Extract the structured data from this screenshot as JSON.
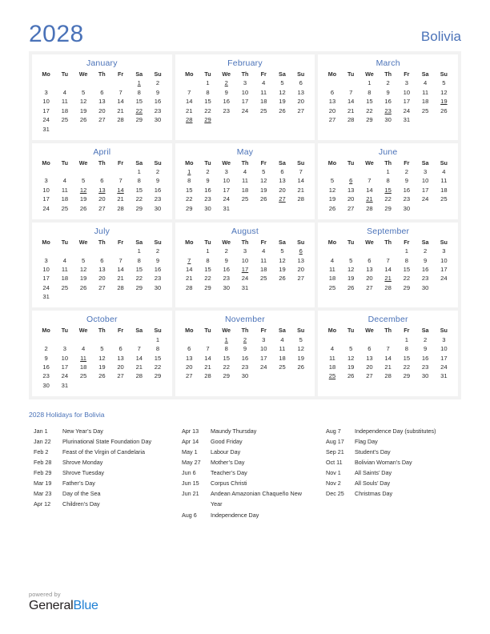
{
  "header": {
    "year": "2028",
    "country": "Bolivia"
  },
  "colors": {
    "accent_blue": "#4a72b8",
    "holiday_red": "#e8000d",
    "panel_gray": "#f2f2f2",
    "brand_blue": "#1d7fd4"
  },
  "weekday_headers": [
    "Mo",
    "Tu",
    "We",
    "Th",
    "Fr",
    "Sa",
    "Su"
  ],
  "months": [
    {
      "name": "January",
      "lead_blanks": 5,
      "days": 31,
      "holidays": [
        1,
        22
      ]
    },
    {
      "name": "February",
      "lead_blanks": 1,
      "days": 29,
      "holidays": [
        2,
        28,
        29
      ]
    },
    {
      "name": "March",
      "lead_blanks": 2,
      "days": 31,
      "holidays": [
        19,
        23
      ]
    },
    {
      "name": "April",
      "lead_blanks": 5,
      "days": 30,
      "holidays": [
        12,
        13,
        14
      ]
    },
    {
      "name": "May",
      "lead_blanks": 0,
      "days": 31,
      "holidays": [
        1,
        27
      ]
    },
    {
      "name": "June",
      "lead_blanks": 3,
      "days": 30,
      "holidays": [
        6,
        15,
        21
      ]
    },
    {
      "name": "July",
      "lead_blanks": 5,
      "days": 31,
      "holidays": []
    },
    {
      "name": "August",
      "lead_blanks": 1,
      "days": 31,
      "holidays": [
        6,
        7,
        17
      ]
    },
    {
      "name": "September",
      "lead_blanks": 4,
      "days": 30,
      "holidays": [
        21
      ]
    },
    {
      "name": "October",
      "lead_blanks": 6,
      "days": 31,
      "holidays": [
        11
      ]
    },
    {
      "name": "November",
      "lead_blanks": 2,
      "days": 30,
      "holidays": [
        1,
        2
      ]
    },
    {
      "name": "December",
      "lead_blanks": 4,
      "days": 31,
      "holidays": [
        25
      ]
    }
  ],
  "holidays_section": {
    "heading": "2028 Holidays for Bolivia",
    "columns": [
      [
        {
          "date": "Jan 1",
          "name": "New Year’s Day"
        },
        {
          "date": "Jan 22",
          "name": "Plurinational State Foundation Day"
        },
        {
          "date": "Feb 2",
          "name": "Feast of the Virgin of Candelaria"
        },
        {
          "date": "Feb 28",
          "name": "Shrove Monday"
        },
        {
          "date": "Feb 29",
          "name": "Shrove Tuesday"
        },
        {
          "date": "Mar 19",
          "name": "Father’s Day"
        },
        {
          "date": "Mar 23",
          "name": "Day of the Sea"
        },
        {
          "date": "Apr 12",
          "name": "Children’s Day"
        }
      ],
      [
        {
          "date": "Apr 13",
          "name": "Maundy Thursday"
        },
        {
          "date": "Apr 14",
          "name": "Good Friday"
        },
        {
          "date": "May 1",
          "name": "Labour Day"
        },
        {
          "date": "May 27",
          "name": "Mother’s Day"
        },
        {
          "date": "Jun 6",
          "name": "Teacher’s Day"
        },
        {
          "date": "Jun 15",
          "name": "Corpus Christi"
        },
        {
          "date": "Jun 21",
          "name": "Andean Amazonian Chaqueño New"
        },
        {
          "date": "",
          "name": "Year",
          "continuation": true
        },
        {
          "date": "Aug 6",
          "name": "Independence Day"
        }
      ],
      [
        {
          "date": "Aug 7",
          "name": "Independence Day (substitutes)"
        },
        {
          "date": "Aug 17",
          "name": "Flag Day"
        },
        {
          "date": "Sep 21",
          "name": "Student’s Day"
        },
        {
          "date": "Oct 11",
          "name": "Bolivian Woman’s Day"
        },
        {
          "date": "Nov 1",
          "name": "All Saints’ Day"
        },
        {
          "date": "Nov 2",
          "name": "All Souls’ Day"
        },
        {
          "date": "Dec 25",
          "name": "Christmas Day"
        }
      ]
    ]
  },
  "footer": {
    "powered_by": "powered by",
    "brand_first": "General",
    "brand_second": "Blue"
  }
}
